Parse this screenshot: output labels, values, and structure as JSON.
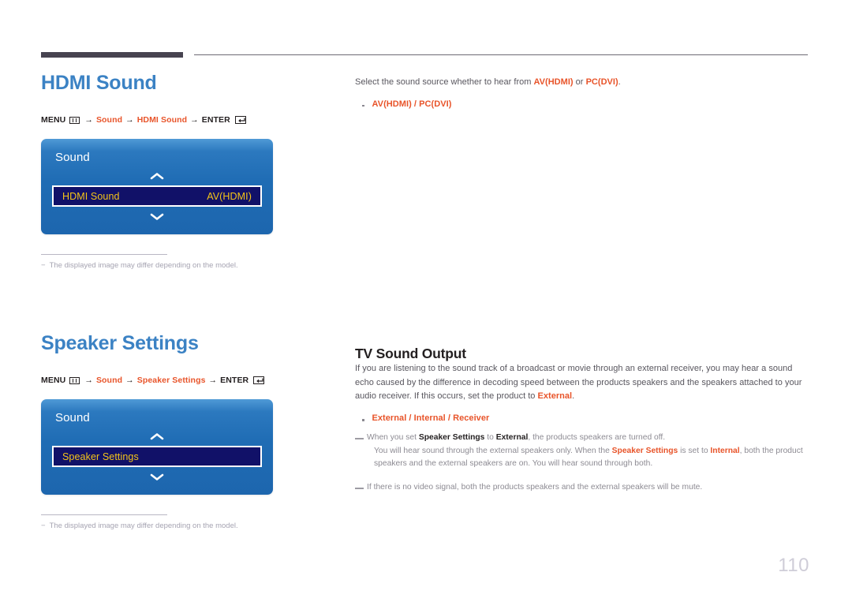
{
  "page": {
    "number": "110"
  },
  "sections": {
    "hdmi_sound": {
      "title": "HDMI Sound",
      "menu_path": {
        "menu_label": "MENU",
        "menu_icon": "menu-icon",
        "arrow": "→",
        "step1": "Sound",
        "step2": "HDMI Sound",
        "enter_label": "ENTER",
        "enter_icon": "enter-return-icon"
      },
      "osd": {
        "title": "Sound",
        "arrow_up_icon": "chevron-up-icon",
        "arrow_down_icon": "chevron-down-icon",
        "row_label": "HDMI Sound",
        "row_value": "AV(HDMI)"
      },
      "note": "The displayed image may differ depending on the model."
    },
    "speaker_settings": {
      "title": "Speaker Settings",
      "menu_path": {
        "menu_label": "MENU",
        "menu_icon": "menu-icon",
        "arrow": "→",
        "step1": "Sound",
        "step2": "Speaker Settings",
        "enter_label": "ENTER",
        "enter_icon": "enter-return-icon"
      },
      "osd": {
        "title": "Sound",
        "arrow_up_icon": "chevron-up-icon",
        "arrow_down_icon": "chevron-down-icon",
        "row_label": "Speaker Settings",
        "row_value": ""
      },
      "note": "The displayed image may differ depending on the model."
    }
  },
  "right": {
    "hdmi_sound": {
      "intro_pre": "Select the sound source whether to hear from ",
      "intro_opt1": "AV(HDMI)",
      "intro_mid": " or ",
      "intro_opt2": "PC(DVI)",
      "intro_post": ".",
      "option_list": "AV(HDMI) / PC(DVI)"
    },
    "tv_sound_output": {
      "heading": "TV Sound Output",
      "paragraph_pre": "If you are listening to the sound track of a broadcast or movie through an external receiver, you may hear a sound echo caused by the difference in decoding speed between the products speakers and the speakers attached to your audio receiver. If this occurs, set the product to ",
      "paragraph_accent": "External",
      "paragraph_post": ".",
      "option_list": "External / Internal / Receiver",
      "note1": {
        "p1": "When you set ",
        "b1": "Speaker Settings",
        "p2": " to ",
        "b2": "External",
        "p3": ", the products speakers are turned off.",
        "l2_p1": "You will hear sound through the external speakers only. When the ",
        "l2_b1": "Speaker Settings",
        "l2_p2": " is set to ",
        "l2_b2": "Internal",
        "l2_p3": ", both the product speakers and the external speakers are on. You will hear sound through both."
      },
      "note2": "If there is no video signal, both the products speakers and the external speakers will be mute."
    }
  },
  "colors": {
    "heading_blue": "#3b82c4",
    "accent_orange": "#e8542a",
    "osd_blue": "#1f6cb4",
    "osd_row_navy": "#111168",
    "osd_row_text": "#f5c518",
    "rule_dark": "#474350",
    "page_number": "#cfcdd8"
  }
}
